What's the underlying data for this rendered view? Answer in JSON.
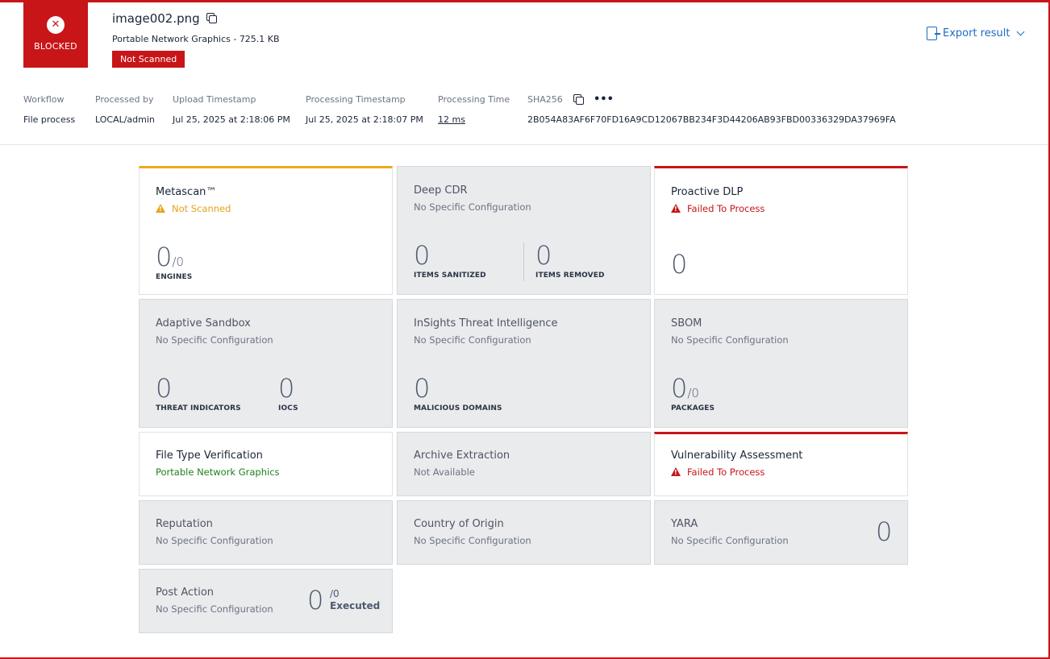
{
  "header": {
    "status_label": "BLOCKED",
    "file_name": "image002.png",
    "file_type_size": "Portable Network Graphics - 725.1 KB",
    "scan_badge": "Not Scanned",
    "export_label": "Export result"
  },
  "meta": {
    "workflow_label": "Workflow",
    "workflow_value": "File process",
    "processed_by_label": "Processed by",
    "processed_by_value": "LOCAL/admin",
    "upload_label": "Upload Timestamp",
    "upload_value": "Jul 25, 2025 at 2:18:06 PM",
    "processing_ts_label": "Processing Timestamp",
    "processing_ts_value": "Jul 25, 2025 at 2:18:07 PM",
    "processing_time_label": "Processing Time",
    "processing_time_value": "12 ms",
    "sha_label": "SHA256",
    "sha_value": "2B054A83AF6F70FD16A9CD12067BB234F3D44206AB93FBD00336329DA37969FA",
    "more_label": "•••"
  },
  "cards": {
    "metascan": {
      "title": "Metascan™",
      "status": "Not Scanned",
      "count": "0",
      "total": "/0",
      "unit": "ENGINES"
    },
    "deep_cdr": {
      "title": "Deep CDR",
      "status": "No Specific Configuration",
      "sanitized": "0",
      "sanitized_label": "ITEMS SANITIZED",
      "removed": "0",
      "removed_label": "ITEMS REMOVED"
    },
    "proactive_dlp": {
      "title": "Proactive DLP",
      "status": "Failed To Process",
      "count": "0"
    },
    "sandbox": {
      "title": "Adaptive Sandbox",
      "status": "No Specific Configuration",
      "threats": "0",
      "threats_label": "THREAT INDICATORS",
      "iocs": "0",
      "iocs_label": "IOCS"
    },
    "insights": {
      "title": "InSights Threat Intelligence",
      "status": "No Specific Configuration",
      "domains": "0",
      "domains_label": "MALICIOUS DOMAINS"
    },
    "sbom": {
      "title": "SBOM",
      "status": "No Specific Configuration",
      "count": "0",
      "total": "/0",
      "unit": "PACKAGES"
    },
    "ftv": {
      "title": "File Type Verification",
      "status": "Portable Network Graphics"
    },
    "archive": {
      "title": "Archive Extraction",
      "status": "Not Available"
    },
    "vuln": {
      "title": "Vulnerability Assessment",
      "status": "Failed To Process"
    },
    "reputation": {
      "title": "Reputation",
      "status": "No Specific Configuration"
    },
    "country": {
      "title": "Country of Origin",
      "status": "No Specific Configuration"
    },
    "yara": {
      "title": "YARA",
      "status": "No Specific Configuration",
      "count": "0"
    },
    "post_action": {
      "title": "Post Action",
      "status": "No Specific Configuration",
      "count": "0",
      "total": "/0",
      "unit": "Executed"
    }
  }
}
